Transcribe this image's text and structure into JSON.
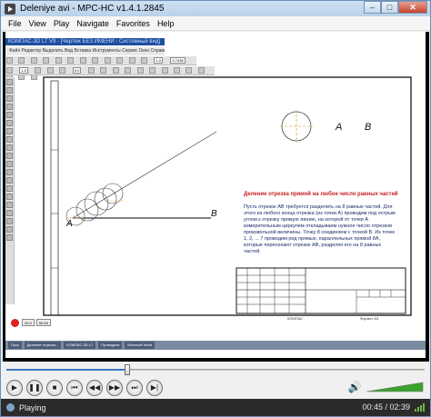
{
  "window": {
    "title": "Deleniye avi - MPC-HC v1.4.1.2845",
    "minimize": "–",
    "maximize": "□",
    "close": "✕"
  },
  "menu": [
    "File",
    "View",
    "Play",
    "Navigate",
    "Favorites",
    "Help"
  ],
  "video": {
    "inner_window_title": "КОМПАС-3D LT V9 - [Чертеж БЕЗ ИМЕНИ - Системный вид]",
    "inner_menu": "Файл  Редактор  Выделить  Вид  Вставка  Инструменты  Сервис  Окно  Справка",
    "inner_field_1": "1.0",
    "inner_field_2": "0.7436",
    "inner_field_3": "0.0",
    "zoom_field": "1.0",
    "label_a_line": "A",
    "label_b_line": "B",
    "label_a_right": "A",
    "label_b_right": "B",
    "description_title": "Деление отрезка прямой на любое число равных частей",
    "description_body": "Пусть отрезок AB требуется разделить на 8 равных частей. Для этого из любого конца отрезка (из точки A) проводим под острым углом к отрезку прямую линию, на которой от точки A измерительным циркулем откладываем нужное число отрезков произвольной величины. Точку 8 соединяем с точкой B. Из точек 1, 2, ... 7 проводим ряд прямых, параллельных прямой 8A, которые пересекают отрезок AB, разделяя его на 8 равных частей.",
    "doc_number": "КОМПАС",
    "format_label": "Формат  A3",
    "status_field_1": "20.0",
    "status_field_2": "50.83",
    "taskbar_items": [
      "Пуск",
      "Деление отрезка...",
      "КОМПАС-3D LT",
      "Проводник",
      "Microsoft Word"
    ]
  },
  "player": {
    "seek_progress": 0.29,
    "volume_level": 1.0,
    "status": "Playing",
    "time": "00:45 / 02:39"
  },
  "colors": {
    "accent": "#3a78c2",
    "red_title": "#c62020",
    "text_blue": "#1a2a6a"
  }
}
